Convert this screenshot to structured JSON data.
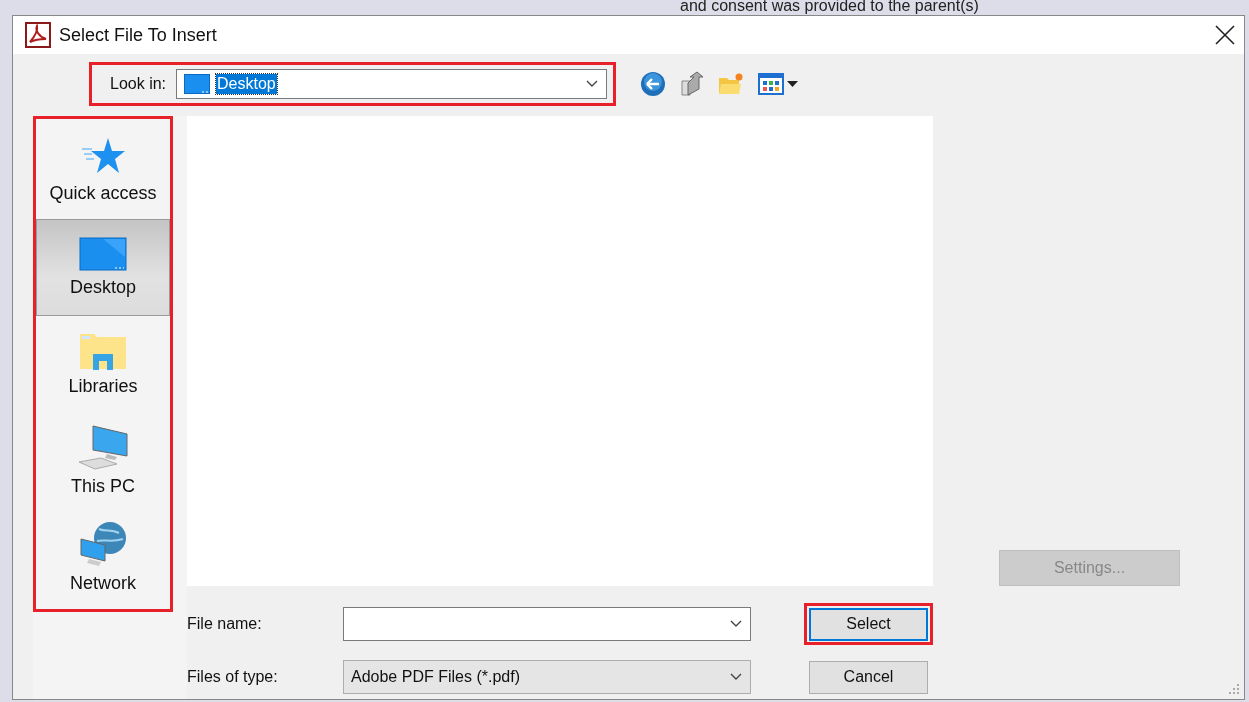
{
  "background_text": "and consent was provided to the parent(s)",
  "window": {
    "title": "Select File To Insert"
  },
  "look_in": {
    "label": "Look in:",
    "value": "Desktop",
    "highlighted": true
  },
  "places": {
    "highlighted": true,
    "items": [
      {
        "label": "Quick access",
        "kind": "star",
        "selected": false
      },
      {
        "label": "Desktop",
        "kind": "desktop",
        "selected": true
      },
      {
        "label": "Libraries",
        "kind": "libraries",
        "selected": false
      },
      {
        "label": "This PC",
        "kind": "computer",
        "selected": false
      },
      {
        "label": "Network",
        "kind": "network",
        "selected": false
      }
    ]
  },
  "settings_button": {
    "label": "Settings...",
    "disabled": true
  },
  "file_name": {
    "label": "File name:"
  },
  "files_of_type": {
    "label": "Files of type:",
    "value": "Adobe PDF Files (*.pdf)"
  },
  "buttons": [
    {
      "label": "Select",
      "default": true,
      "highlighted": true
    },
    {
      "label": "Cancel",
      "default": false,
      "highlighted": false
    }
  ]
}
